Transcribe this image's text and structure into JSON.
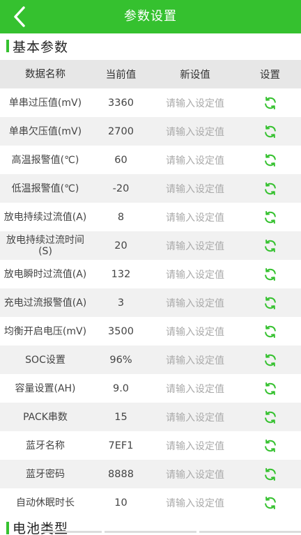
{
  "header": {
    "title": "参数设置",
    "back_icon": "chevron-left-icon"
  },
  "basic_section": {
    "title": "基本参数"
  },
  "battery_section": {
    "title": "电池类型"
  },
  "table": {
    "headers": [
      "数据名称",
      "当前值",
      "新设值",
      "设置"
    ],
    "placeholder": "请输入设定值",
    "rows": [
      {
        "name": "单串过压值(mV)",
        "value": "3360"
      },
      {
        "name": "单串欠压值(mV)",
        "value": "2700"
      },
      {
        "name": "高温报警值(℃)",
        "value": "60"
      },
      {
        "name": "低温报警值(℃)",
        "value": "-20"
      },
      {
        "name": "放电持续过流值(A)",
        "value": "8"
      },
      {
        "name": "放电持续过流时间(S)",
        "value": "20"
      },
      {
        "name": "放电瞬时过流值(A)",
        "value": "132"
      },
      {
        "name": "充电过流报警值(A)",
        "value": "3"
      },
      {
        "name": "均衡开启电压(mV)",
        "value": "3500"
      },
      {
        "name": "SOC设置",
        "value": "96%"
      },
      {
        "name": "容量设置(AH)",
        "value": "9.0"
      },
      {
        "name": "PACK串数",
        "value": "15"
      },
      {
        "name": "蓝牙名称",
        "value": "7EF1"
      },
      {
        "name": "蓝牙密码",
        "value": "8888"
      },
      {
        "name": "自动休眠时长",
        "value": "10"
      }
    ]
  },
  "colors": {
    "accent": "#35c12f",
    "refresh_icon": "#35c12f"
  },
  "icons": {
    "refresh": "refresh-icon"
  }
}
